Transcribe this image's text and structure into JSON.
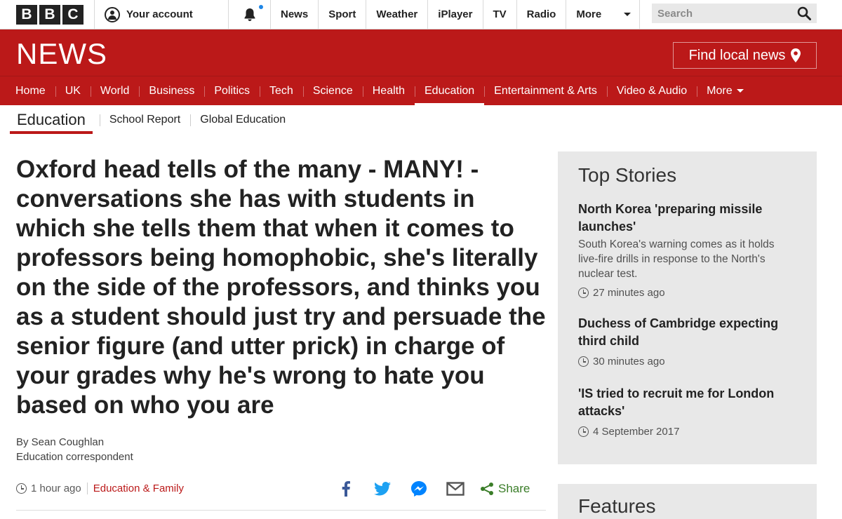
{
  "global_nav": {
    "brand": [
      "B",
      "B",
      "C"
    ],
    "account_label": "Your account",
    "links": [
      "News",
      "Sport",
      "Weather",
      "iPlayer",
      "TV",
      "Radio"
    ],
    "more_label": "More",
    "search_placeholder": "Search"
  },
  "masthead": {
    "logo_text": "NEWS",
    "local_news_label": "Find local news"
  },
  "section_nav": {
    "items": [
      "Home",
      "UK",
      "World",
      "Business",
      "Politics",
      "Tech",
      "Science",
      "Health",
      "Education",
      "Entertainment & Arts",
      "Video & Audio"
    ],
    "active": "Education",
    "more_label": "More"
  },
  "sub_nav": {
    "title": "Education",
    "items": [
      "School Report",
      "Global Education"
    ]
  },
  "article": {
    "headline": "Oxford head tells of the many - MANY! - conversations she has with students in which she tells them that when it comes to professors being homophobic, she's literally on the side of the professors, and thinks you as a student should just try and persuade the senior figure (and utter prick) in charge of your grades why he's wrong to hate you based on who you are",
    "author": "By Sean Coughlan",
    "author_role": "Education correspondent",
    "time": "1 hour ago",
    "category": "Education & Family",
    "share_label": "Share"
  },
  "top_stories": {
    "title": "Top Stories",
    "stories": [
      {
        "headline": "North Korea 'preparing missile launches'",
        "summary": "South Korea's warning comes as it holds live-fire drills in response to the North's nuclear test.",
        "time": "27 minutes ago"
      },
      {
        "headline": "Duchess of Cambridge expecting third child",
        "summary": "",
        "time": "30 minutes ago"
      },
      {
        "headline": "'IS tried to recruit me for London attacks'",
        "summary": "",
        "time": "4 September 2017"
      }
    ]
  },
  "features": {
    "title": "Features"
  },
  "colors": {
    "bbc_red": "#bb1919",
    "share_green": "#3a7d28",
    "facebook_blue": "#3b5998",
    "twitter_blue": "#1da1f2",
    "messenger_blue": "#0084ff"
  }
}
